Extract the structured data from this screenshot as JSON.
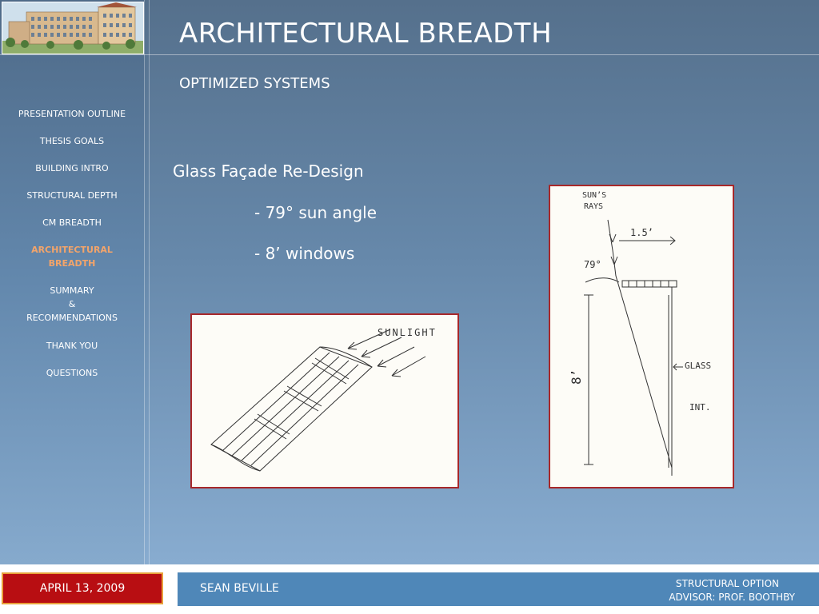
{
  "slide": {
    "title": "ARCHITECTURAL BREADTH",
    "subtitle": "OPTIMIZED SYSTEMS"
  },
  "nav": {
    "items": [
      {
        "label": "PRESENTATION OUTLINE"
      },
      {
        "label": "THESIS GOALS"
      },
      {
        "label": "BUILDING INTRO"
      },
      {
        "label": "STRUCTURAL DEPTH"
      },
      {
        "label": "CM BREADTH"
      },
      {
        "label_line1": "ARCHITECTURAL",
        "label_line2": "BREADTH",
        "active": true
      },
      {
        "label_line1": "SUMMARY",
        "label_line2": "&",
        "label_line3": "RECOMMENDATIONS"
      },
      {
        "label": "THANK YOU"
      },
      {
        "label": "QUESTIONS"
      }
    ],
    "active_color": "#f3a46a"
  },
  "content": {
    "heading": "Glass Façade Re-Design",
    "bullet1": "- 79° sun angle",
    "bullet2": "- 8’ windows"
  },
  "sketch_left": {
    "label": "SUNLIGHT"
  },
  "sketch_right": {
    "label_suns": "SUN’S",
    "label_rays": "RAYS",
    "label_dim": "1.5’",
    "label_angle": "79°",
    "label_height": "8’",
    "label_glass": "GLASS",
    "label_int": "INT."
  },
  "footer": {
    "date": "APRIL 13, 2009",
    "author": "SEAN BEVILLE",
    "option": "STRUCTURAL OPTION",
    "advisor": "ADVISOR:  PROF. BOOTHBY"
  },
  "colors": {
    "background_top": "#55708c",
    "background_bottom": "#88acd0",
    "sketch_border": "#a8282a",
    "date_box": "#b80e12",
    "date_border": "#e8a03a",
    "author_bar": "#4f87b8"
  }
}
